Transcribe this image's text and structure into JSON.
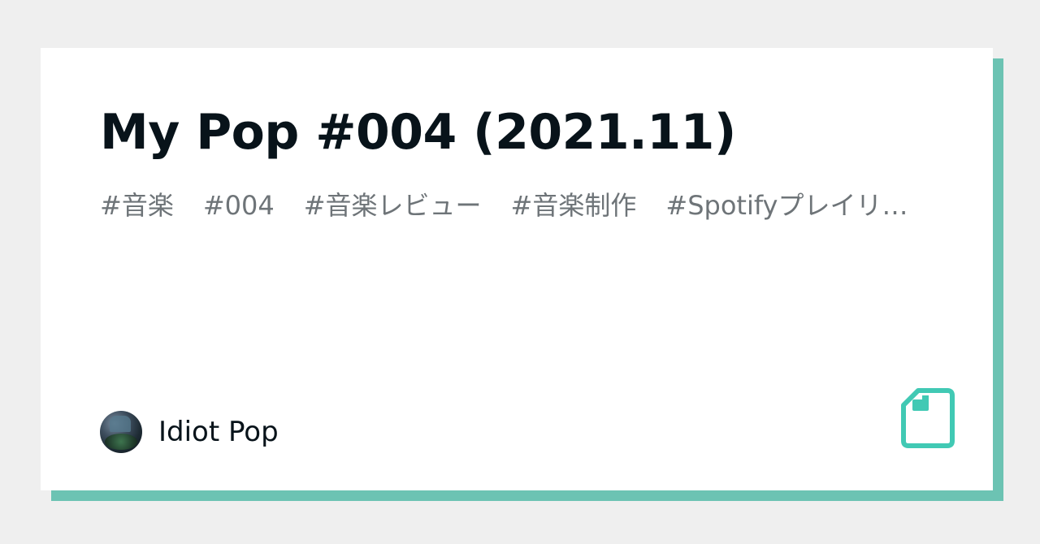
{
  "card": {
    "title": "My Pop #004 (2021.11)",
    "tags": [
      "#音楽",
      "#004",
      "#音楽レビュー",
      "#音楽制作",
      "#Spotifyプレイリ…"
    ],
    "author": {
      "name": "Idiot Pop"
    },
    "icon": "note-document-icon"
  },
  "colors": {
    "accent": "#41c9b4",
    "shadow": "#6cc3b3",
    "background": "#efefef",
    "card": "#ffffff",
    "title_text": "#08131a",
    "tag_text": "#6e7478"
  }
}
